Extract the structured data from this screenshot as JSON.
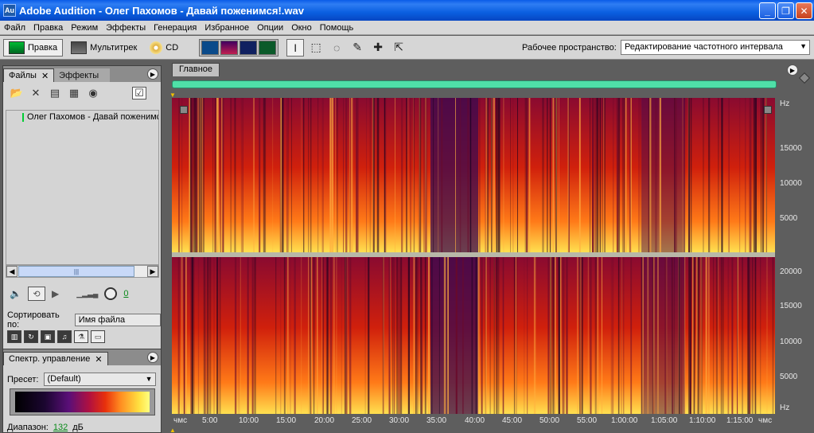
{
  "window": {
    "app_icon": "Au",
    "title": "Adobe Audition - Олег Пахомов - Давай поженимся!.wav",
    "buttons": [
      "_",
      "❐",
      "✕"
    ]
  },
  "menu": [
    "Файл",
    "Правка",
    "Режим",
    "Эффекты",
    "Генерация",
    "Избранное",
    "Опции",
    "Окно",
    "Помощь"
  ],
  "toolbar": {
    "edit_label": "Правка",
    "multitrack_label": "Мультитрек",
    "cd_label": "CD",
    "workspace_label": "Рабочее пространство:",
    "workspace_value": "Редактирование частотного интервала"
  },
  "files_panel": {
    "tab_files": "Файлы",
    "tab_effects": "Эффекты",
    "file_name": "Олег Пахомов - Давай поженимся!.wav",
    "volume_value": "0",
    "sort_label": "Сортировать по:",
    "sort_value": "Имя файла"
  },
  "spectral_panel": {
    "title": "Спектр. управление",
    "preset_label": "Пресет:",
    "preset_value": "(Default)",
    "range_label": "Диапазон:",
    "range_value": "132",
    "range_unit": "дБ"
  },
  "main": {
    "tab": "Главное",
    "hz_labels_ch1": [
      "Hz",
      "15000",
      "10000",
      "5000"
    ],
    "hz_labels_ch2": [
      "20000",
      "15000",
      "10000",
      "5000",
      "Hz"
    ],
    "time_labels": [
      "чмс",
      "5:00",
      "10:00",
      "15:00",
      "20:00",
      "25:00",
      "30:00",
      "35:00",
      "40:00",
      "45:00",
      "50:00",
      "55:00",
      "1:00:00",
      "1:05:00",
      "1:10:00",
      "1:15:00",
      "чмс"
    ]
  },
  "colors": {
    "titlebar": "#0a5ce8",
    "overview": "#4fe0a8",
    "spectrum_low": "#b01040",
    "spectrum_high": "#ffe040"
  }
}
